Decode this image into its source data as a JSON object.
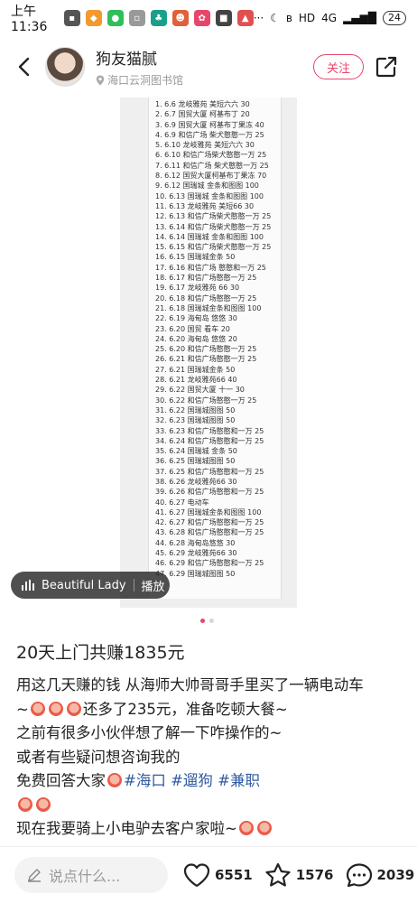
{
  "status_bar": {
    "time": "上午11:36",
    "network": "4G",
    "signal_label": "HD",
    "battery": "24"
  },
  "header": {
    "author_name": "狗友猫腻",
    "location": "海口云洞图书馆",
    "follow_label": "关注"
  },
  "image": {
    "records": [
      "1. 6.6 龙岐雅苑 美短六六 30",
      "2. 6.7 国贸大厦 柯基布丁 20",
      "3. 6.9 国贸大厦 柯基布丁果冻 40",
      "4. 6.9 和信广场 柴犬憨憨一万 25",
      "5. 6.10 龙岐雅苑 美短六六 30",
      "6. 6.10 和信广场柴犬憨憨一万 25",
      "7. 6.11 和信广场 柴犬憨憨一万 25",
      "8. 6.12 国贸大厦柯基布丁果冻 70",
      "9. 6.12 国瑞城 金条和图图 100",
      "10. 6.13 国瑞城 金条和图图 100",
      "11. 6.13 龙岐雅苑 美短66 30",
      "12. 6.13 和信广场柴犬憨憨一万 25",
      "13. 6.14 和信广场柴犬憨憨一万 25",
      "14. 6.14 国瑞城 金条和图图 100",
      "15. 6.15 和信广场柴犬憨憨一万 25",
      "16. 6.15 国瑞城金条 50",
      "17. 6.16 和信广场 憨憨和一万 25",
      "18. 6.17 和信广场憨憨一万 25",
      "19. 6.17 龙岐雅苑 66 30",
      "20. 6.18 和信广场憨憨一万 25",
      "21. 6.18 国瑞城金条和图图 100",
      "22. 6.19 海甸岛 悠悠 30",
      "23. 6.20 国贸 看车 20",
      "24. 6.20 海甸岛 悠悠 20",
      "25. 6.20 和信广场憨憨一万 25",
      "26. 6.21 和信广场憨憨一万 25",
      "27. 6.21 国瑞城金条 50",
      "28. 6.21 龙岐雅苑66 40",
      "29. 6.22 国贸大厦 十一 30",
      "30. 6.22 和信广场憨憨一万 25",
      "31. 6.22 国瑞城图图 50",
      "32. 6.23 国瑞城图图 50",
      "33. 6.23 和信广场憨憨和一万 25",
      "34. 6.24 和信广场憨憨和一万 25",
      "35. 6.24 国瑞城 金条 50",
      "36. 6.25 国瑞城图图 50",
      "37. 6.25 和信广场憨憨和一万 25",
      "38. 6.26 龙岐雅苑66 30",
      "39. 6.26 和信广场憨憨和一万 25",
      "40. 6.27 电动车",
      "41. 6.27 国瑞城金条和图图 100",
      "42. 6.27 和信广场憨憨和一万 25",
      "43. 6.28 和信广场憨憨和一万 25",
      "44. 6.28 海甸岛悠悠 30",
      "45. 6.29 龙岐雅苑66 30",
      "46. 6.29 和信广场憨憨和一万 25",
      "47. 6.29 国瑞城图图 50"
    ],
    "music_title": "Beautiful Lady",
    "music_action": "播放",
    "page_count": 2,
    "current_page": 1
  },
  "post": {
    "title": "20天上门共赚1835元",
    "line1": "用这几天赚的钱 从海师大帅哥哥手里买了一辆电动车",
    "line2_prefix": "~",
    "line2_suffix": "还多了235元，准备吃顿大餐~",
    "line3": "之前有很多小伙伴想了解一下咋操作的~",
    "line4": "或者有些疑问想咨询我的",
    "line5_prefix": "免费回答大家",
    "tags": [
      "#海口",
      "#遛狗",
      "#兼职"
    ],
    "line7": "现在我要骑上小电驴去客户家啦~"
  },
  "bottom_bar": {
    "comment_placeholder": "说点什么...",
    "likes": "6551",
    "collects": "1576",
    "comments": "2039"
  },
  "colors": {
    "accent": "#e8456b",
    "tag": "#2f5b9e"
  }
}
